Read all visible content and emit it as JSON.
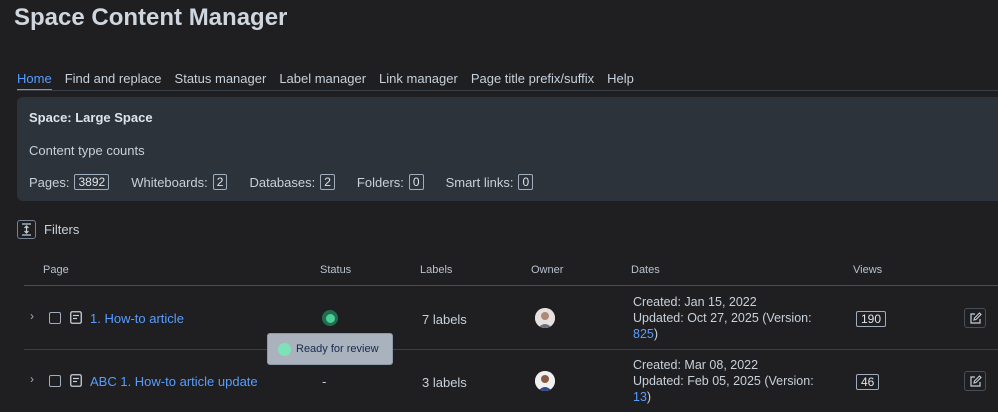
{
  "app": {
    "title": "Space Content Manager"
  },
  "tabs": [
    {
      "label": "Home",
      "active": true
    },
    {
      "label": "Find and replace"
    },
    {
      "label": "Status manager"
    },
    {
      "label": "Label manager"
    },
    {
      "label": "Link manager"
    },
    {
      "label": "Page title prefix/suffix"
    },
    {
      "label": "Help"
    }
  ],
  "space": {
    "title": "Space: Large Space",
    "counts_heading": "Content type counts",
    "counts": [
      {
        "label": "Pages:",
        "value": "3892"
      },
      {
        "label": "Whiteboards:",
        "value": "2"
      },
      {
        "label": "Databases:",
        "value": "2"
      },
      {
        "label": "Folders:",
        "value": "0"
      },
      {
        "label": "Smart links:",
        "value": "0"
      }
    ]
  },
  "filters": {
    "label": "Filters"
  },
  "table": {
    "headers": {
      "page": "Page",
      "status": "Status",
      "labels": "Labels",
      "owner": "Owner",
      "dates": "Dates",
      "views": "Views"
    },
    "rows": [
      {
        "title": "1. How-to article",
        "status": "Ready for review",
        "status_text": "",
        "labels": "7 labels",
        "created": "Created: Jan 15, 2022",
        "updated": "Updated: Oct 27, 2025 (Version:",
        "version": "825",
        "version_suffix": ")",
        "views": "190"
      },
      {
        "title": "ABC 1. How-to article update",
        "status": "",
        "status_text": "-",
        "labels": "3 labels",
        "created": "Created: Mar 08, 2022",
        "updated": "Updated: Feb 05, 2025 (Version:",
        "version": "13",
        "version_suffix": ")",
        "views": "46"
      }
    ]
  },
  "tooltip": {
    "text": "Ready for review"
  },
  "colors": {
    "background": "#1f1f21",
    "accent": "#579dff",
    "status_green": "#4bce97",
    "panel": "#2c333a"
  }
}
